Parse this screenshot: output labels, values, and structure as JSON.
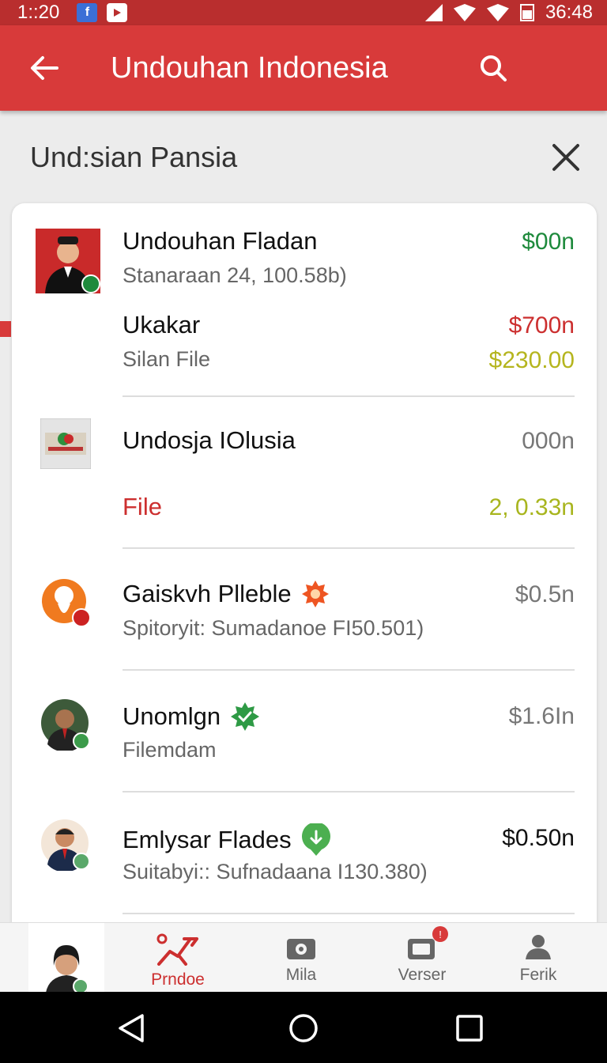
{
  "status_bar": {
    "time": "1::20",
    "clock": "36:48",
    "fb_glyph": "f"
  },
  "app_bar": {
    "title": "Undouhan Indonesia"
  },
  "sub_header": {
    "title": "Und:sian Pansia"
  },
  "list": [
    {
      "title": "Undouhan Fladan",
      "subtitle": "Stanaraan 24, 100.58b)",
      "amount": "$00n",
      "amount_color": "#1e8a3c"
    },
    {
      "title": "Ukakar",
      "subtitle": "Silan File",
      "amount": "$700n",
      "amount_color": "#cc2f2f",
      "amount2": "$230.00",
      "amount2_color": "#b5b51e"
    },
    {
      "title": "Undosja IOlusia",
      "subtitle": "File",
      "amount": "000n",
      "amount_color": "#777777",
      "amount2": "2, 0.33n",
      "amount2_color": "#a8b51e"
    },
    {
      "title": "Gaiskvh Plleble",
      "subtitle": "Spitoryit: Sumadanoe FI50.501)",
      "amount": "$0.5n",
      "amount_color": "#777777"
    },
    {
      "title": "Unomlgn",
      "subtitle": "Filemdam",
      "amount": "$1.6In",
      "amount_color": "#777777"
    },
    {
      "title": "Emlysar Flades",
      "subtitle": "Suitabyi:: Sufnadaana I130.380)",
      "amount": "$0.50n",
      "amount_color": "#111111"
    }
  ],
  "bottom_nav": {
    "items": [
      {
        "label": "Prndoe",
        "icon": "chart-arrow-icon",
        "active": true
      },
      {
        "label": "Mila",
        "icon": "camera-icon"
      },
      {
        "label": "Verser",
        "icon": "video-icon",
        "badge": "!"
      },
      {
        "label": "Ferik",
        "icon": "person-icon"
      }
    ]
  },
  "colors": {
    "primary": "#d83a3a",
    "status_bar": "#b92e2e",
    "accent_text": "#cc2f2f"
  }
}
